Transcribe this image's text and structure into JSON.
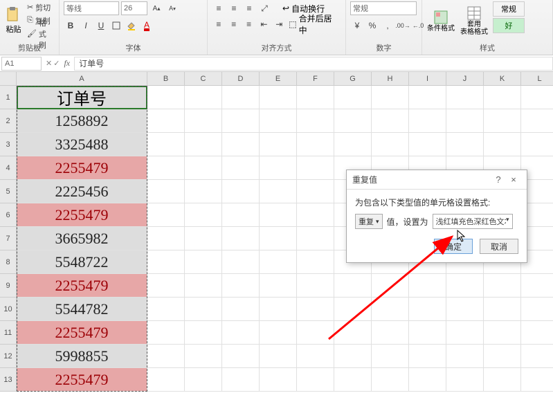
{
  "ribbon": {
    "clipboard": {
      "paste": "粘贴",
      "cut": "剪切",
      "copy": "复制",
      "format_painter": "格式刷",
      "label": "剪贴板"
    },
    "font": {
      "name": "等线",
      "size": "26",
      "bold": "B",
      "italic": "I",
      "underline": "U",
      "label": "字体"
    },
    "alignment": {
      "wrap": "自动换行",
      "merge": "合并后居中",
      "label": "对齐方式"
    },
    "number": {
      "format": "常规",
      "label": "数字"
    },
    "styles": {
      "conditional": "条件格式",
      "table_format": "套用\n表格格式",
      "normal": "常规",
      "good": "好",
      "label": "样式"
    }
  },
  "formula_bar": {
    "name_box": "A1",
    "formula": "订单号"
  },
  "columns": [
    "A",
    "B",
    "C",
    "D",
    "E",
    "F",
    "G",
    "H",
    "I",
    "J",
    "K",
    "L"
  ],
  "rows": [
    1,
    2,
    3,
    4,
    5,
    6,
    7,
    8,
    9,
    10,
    11,
    12,
    13
  ],
  "data": {
    "header": "订单号",
    "values": [
      "1258892",
      "3325488",
      "2255479",
      "2225456",
      "2255479",
      "3665982",
      "5548722",
      "2255479",
      "5544782",
      "2255479",
      "5998855",
      "2255479"
    ],
    "duplicated": [
      false,
      false,
      true,
      false,
      true,
      false,
      false,
      true,
      false,
      true,
      false,
      true
    ]
  },
  "dialog": {
    "title": "重复值",
    "help": "?",
    "close": "×",
    "instruction": "为包含以下类型值的单元格设置格式:",
    "type_value": "重复",
    "middle_text": "值，设置为",
    "format_value": "浅红填充色深红色文本",
    "ok": "确定",
    "cancel": "取消"
  }
}
